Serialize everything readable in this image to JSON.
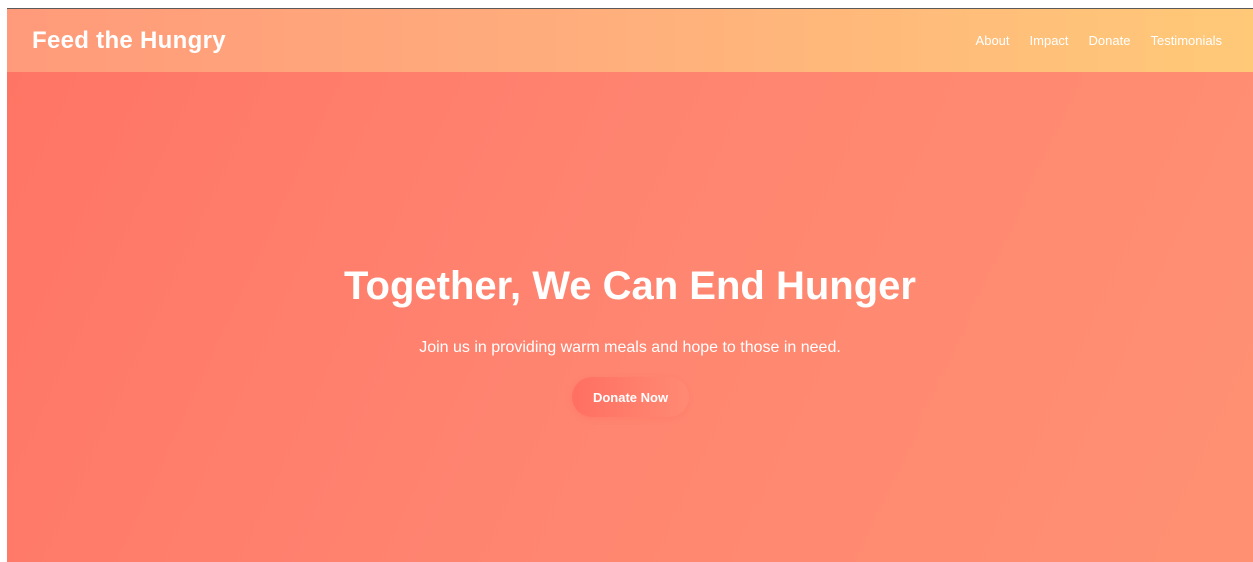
{
  "header": {
    "brand": "Feed the Hungry",
    "nav": [
      {
        "label": "About"
      },
      {
        "label": "Impact"
      },
      {
        "label": "Donate"
      },
      {
        "label": "Testimonials"
      }
    ]
  },
  "hero": {
    "title": "Together, We Can End Hunger",
    "subtitle": "Join us in providing warm meals and hope to those in need.",
    "cta_label": "Donate Now"
  },
  "colors": {
    "header_start": "#ff9a7a",
    "header_end": "#ffc978",
    "hero_start": "#ff7565",
    "hero_end": "#ff9172",
    "text": "#ffffff"
  }
}
